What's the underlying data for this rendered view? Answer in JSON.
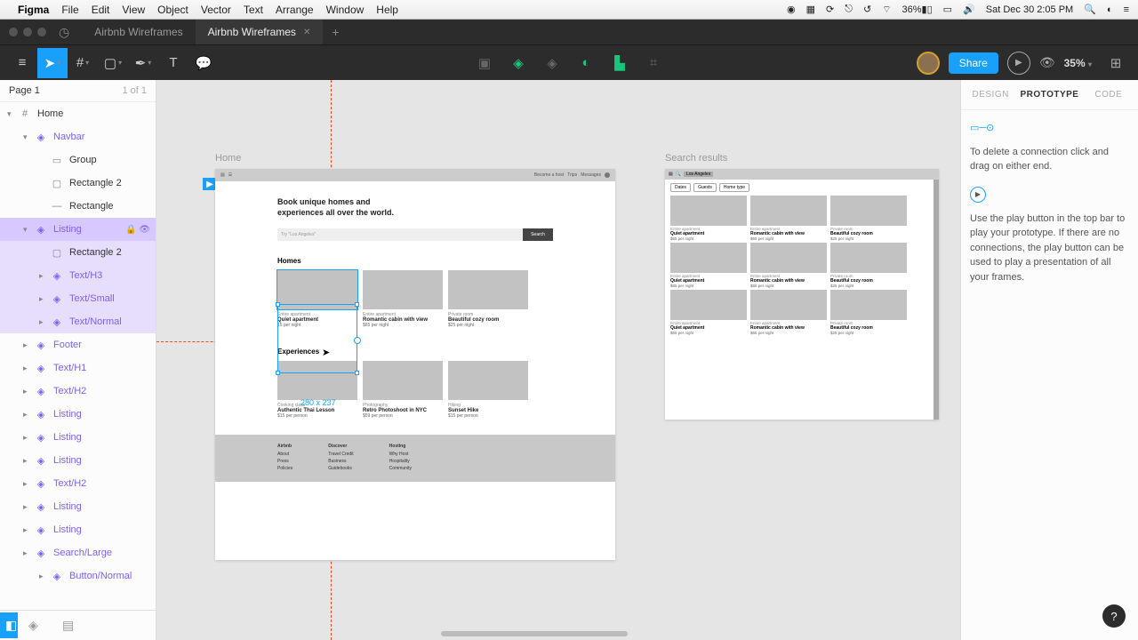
{
  "macbar": {
    "app": "Figma",
    "menus": [
      "File",
      "Edit",
      "View",
      "Object",
      "Vector",
      "Text",
      "Arrange",
      "Window",
      "Help"
    ],
    "battery": "36%",
    "datetime": "Sat Dec 30  2:05 PM"
  },
  "tabs": {
    "inactive": "Airbnb Wireframes",
    "active": "Airbnb Wireframes"
  },
  "toolbar": {
    "share": "Share",
    "zoom": "35%"
  },
  "leftPanel": {
    "page": "Page 1",
    "pageCount": "1 of 1",
    "layers": [
      {
        "name": "Home",
        "type": "frame",
        "indent": 0,
        "open": true
      },
      {
        "name": "Navbar",
        "type": "comp",
        "indent": 1,
        "open": true
      },
      {
        "name": "Group",
        "type": "group",
        "indent": 2
      },
      {
        "name": "Rectangle 2",
        "type": "rect",
        "indent": 2
      },
      {
        "name": "Rectangle",
        "type": "line",
        "indent": 2
      },
      {
        "name": "Listing",
        "type": "comp",
        "indent": 1,
        "selected": true,
        "open": true,
        "vis": true
      },
      {
        "name": "Rectangle 2",
        "type": "rect",
        "indent": 2,
        "hover": true
      },
      {
        "name": "Text/H3",
        "type": "comp",
        "indent": 2,
        "hover": true,
        "arrow": true
      },
      {
        "name": "Text/Small",
        "type": "comp",
        "indent": 2,
        "hover": true,
        "arrow": true
      },
      {
        "name": "Text/Normal",
        "type": "comp",
        "indent": 2,
        "hover": true,
        "arrow": true
      },
      {
        "name": "Footer",
        "type": "comp",
        "indent": 1,
        "arrow": true
      },
      {
        "name": "Text/H1",
        "type": "comp",
        "indent": 1,
        "arrow": true
      },
      {
        "name": "Text/H2",
        "type": "comp",
        "indent": 1,
        "arrow": true
      },
      {
        "name": "Listing",
        "type": "comp",
        "indent": 1,
        "arrow": true
      },
      {
        "name": "Listing",
        "type": "comp",
        "indent": 1,
        "arrow": true
      },
      {
        "name": "Listing",
        "type": "comp",
        "indent": 1,
        "arrow": true
      },
      {
        "name": "Text/H2",
        "type": "comp",
        "indent": 1,
        "arrow": true
      },
      {
        "name": "Listing",
        "type": "comp",
        "indent": 1,
        "arrow": true
      },
      {
        "name": "Listing",
        "type": "comp",
        "indent": 1,
        "arrow": true
      },
      {
        "name": "Search/Large",
        "type": "comp",
        "indent": 1,
        "arrow": true
      },
      {
        "name": "Button/Normal",
        "type": "comp",
        "indent": 2,
        "arrow": true
      }
    ]
  },
  "canvas": {
    "frame1": {
      "label": "Home",
      "heroLine1": "Book unique homes and",
      "heroLine2": "experiences all over the world.",
      "searchPlaceholder": "Try \"Los Angeles\"",
      "searchButton": "Search",
      "navbarRight": [
        "Become a host",
        "Trips",
        "Messages"
      ],
      "homesHeading": "Homes",
      "homes": [
        {
          "tag": "Entire apartment",
          "title": "Quiet apartment",
          "price": "15 per night"
        },
        {
          "tag": "Entire apartment",
          "title": "Romantic cabin with view",
          "price": "$65 per night"
        },
        {
          "tag": "Private room",
          "title": "Beautiful cozy room",
          "price": "$25 per night"
        }
      ],
      "selectionDim": "280 x 237",
      "expHeading": "Experiences",
      "exp": [
        {
          "tag": "Cooking class",
          "title": "Authentic Thai Lesson",
          "price": "$15 per person"
        },
        {
          "tag": "Photography",
          "title": "Retro Photoshoot in NYC",
          "price": "$59 per person"
        },
        {
          "tag": "Hiking",
          "title": "Sunset Hike",
          "price": "$15 per person"
        }
      ],
      "footer": {
        "col1": [
          "Airbnb",
          "About",
          "Press",
          "Policies"
        ],
        "col2": [
          "Discover",
          "Travel Credit",
          "Business",
          "Guidebooks"
        ],
        "col3": [
          "Hosting",
          "Why Host",
          "Hospitality",
          "Community"
        ]
      }
    },
    "frame2": {
      "label": "Search results",
      "location": "Los Angeles",
      "filters": [
        "Dates",
        "Guests",
        "Home type"
      ],
      "items": [
        {
          "tag": "Entire apartment",
          "title": "Quiet apartment",
          "price": "$65 per night"
        },
        {
          "tag": "Entire apartment",
          "title": "Romantic cabin with view",
          "price": "$65 per night"
        },
        {
          "tag": "Private room",
          "title": "Beautiful cozy room",
          "price": "$25 per night"
        }
      ]
    }
  },
  "rightPanel": {
    "tabs": [
      "DESIGN",
      "PROTOTYPE",
      "CODE"
    ],
    "text1": "To delete a connection click and drag on either end.",
    "text2": "Use the play button in the top bar to play your prototype. If there are no connections, the play button can be used to play a presentation of all your frames."
  }
}
